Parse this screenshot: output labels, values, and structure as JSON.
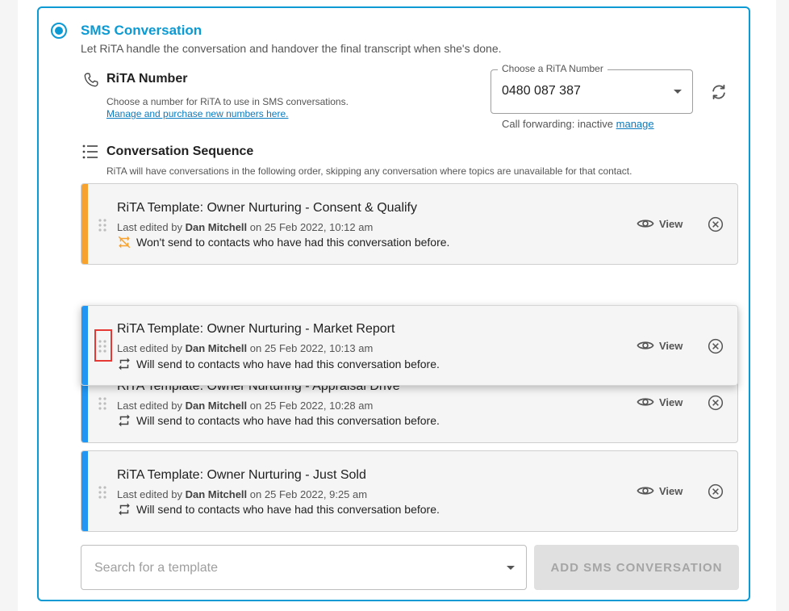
{
  "sms": {
    "title": "SMS Conversation",
    "description": "Let RiTA handle the conversation and handover the final transcript when she's done."
  },
  "rita_number": {
    "title": "RiTA Number",
    "description": "Choose a number for RiTA to use in SMS conversations.",
    "manage_link": "Manage and purchase new numbers here.",
    "select_label": "Choose a RiTA Number",
    "selected": "0480 087 387",
    "forwarding_label": "Call forwarding: inactive",
    "forwarding_link": "manage"
  },
  "sequence": {
    "title": "Conversation Sequence",
    "description": "RiTA will have conversations in the following order, skipping any conversation where topics are unavailable for that contact."
  },
  "common": {
    "last_edited_by": "Last edited by",
    "on": "on",
    "view": "View"
  },
  "cards": [
    {
      "title": "RiTA Template: Owner Nurturing - Consent & Qualify",
      "editor": "Dan Mitchell",
      "date": "25 Feb 2022, 10:12 am",
      "note": "Won't send to contacts who have had this conversation before.",
      "stripe_color": "#f7a12f"
    },
    {
      "title": "RiTA Template: Owner Nurturing - Market Report",
      "editor": "Dan Mitchell",
      "date": "25 Feb 2022, 10:13 am",
      "note": "Will send to contacts who have had this conversation before.",
      "stripe_color": "#2196f3"
    },
    {
      "title": "RiTA Template: Owner Nurturing - Appraisal Drive",
      "editor": "Dan Mitchell",
      "date": "25 Feb 2022, 10:28 am",
      "note": "Will send to contacts who have had this conversation before.",
      "stripe_color": "#2196f3"
    },
    {
      "title": "RiTA Template: Owner Nurturing - Just Sold",
      "editor": "Dan Mitchell",
      "date": "25 Feb 2022, 9:25 am",
      "note": "Will send to contacts who have had this conversation before.",
      "stripe_color": "#2196f3"
    }
  ],
  "search": {
    "placeholder": "Search for a template"
  },
  "add_button": "ADD SMS CONVERSATION",
  "colors": {
    "accent": "#0b9ad3",
    "warning": "#f7a12f",
    "highlight": "#e53935"
  }
}
